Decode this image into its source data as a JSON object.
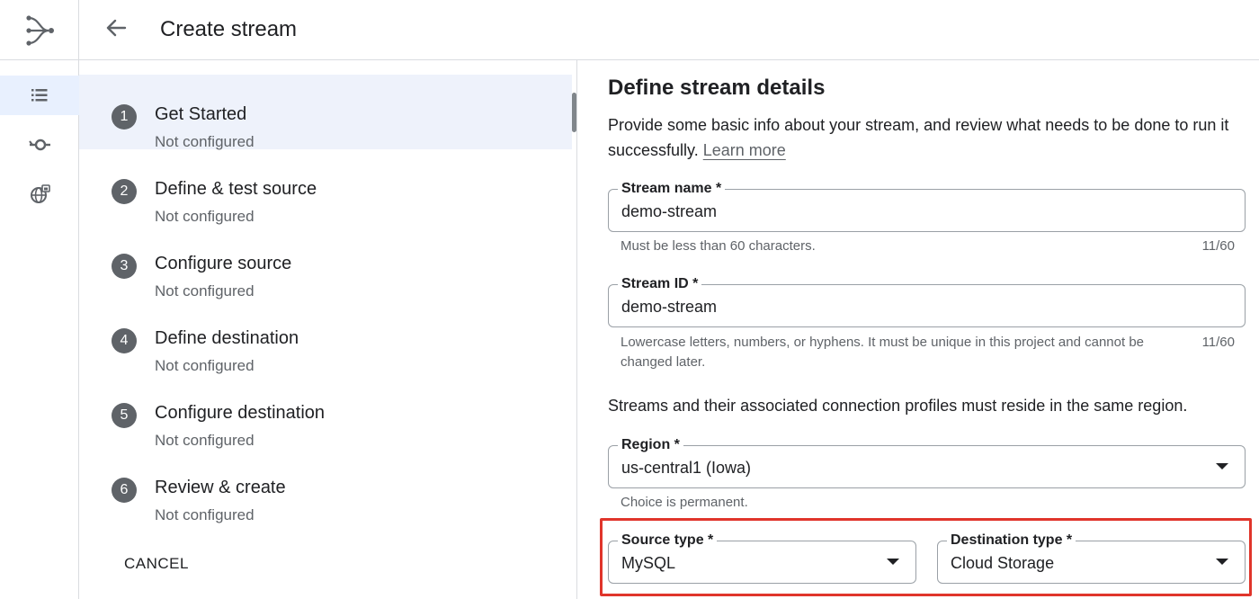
{
  "header": {
    "title": "Create stream"
  },
  "rail": {
    "items": [
      {
        "icon": "list-icon",
        "active": true
      },
      {
        "icon": "connection-profile-icon",
        "active": false
      },
      {
        "icon": "private-connectivity-icon",
        "active": false
      }
    ]
  },
  "steps": [
    {
      "number": "1",
      "title": "Get Started",
      "status": "Not configured",
      "active": true
    },
    {
      "number": "2",
      "title": "Define & test source",
      "status": "Not configured",
      "active": false
    },
    {
      "number": "3",
      "title": "Configure source",
      "status": "Not configured",
      "active": false
    },
    {
      "number": "4",
      "title": "Define destination",
      "status": "Not configured",
      "active": false
    },
    {
      "number": "5",
      "title": "Configure destination",
      "status": "Not configured",
      "active": false
    },
    {
      "number": "6",
      "title": "Review & create",
      "status": "Not configured",
      "active": false
    }
  ],
  "cancel_label": "CANCEL",
  "form": {
    "section_title": "Define stream details",
    "description": "Provide some basic info about your stream, and review what needs to be done to run it successfully.",
    "learn_more": "Learn more",
    "stream_name": {
      "label": "Stream name *",
      "value": "demo-stream",
      "hint": "Must be less than 60 characters.",
      "counter": "11/60"
    },
    "stream_id": {
      "label": "Stream ID *",
      "value": "demo-stream",
      "hint": "Lowercase letters, numbers, or hyphens. It must be unique in this project and cannot be changed later.",
      "counter": "11/60"
    },
    "region_note": "Streams and their associated connection profiles must reside in the same region.",
    "region": {
      "label": "Region *",
      "value": "us-central1 (Iowa)",
      "hint": "Choice is permanent."
    },
    "source_type": {
      "label": "Source type *",
      "value": "MySQL"
    },
    "destination_type": {
      "label": "Destination type *",
      "value": "Cloud Storage"
    }
  },
  "colors": {
    "accent_highlight": "#e0352b",
    "active_step_bg": "#eef2fb",
    "step_badge": "#5f6368"
  }
}
